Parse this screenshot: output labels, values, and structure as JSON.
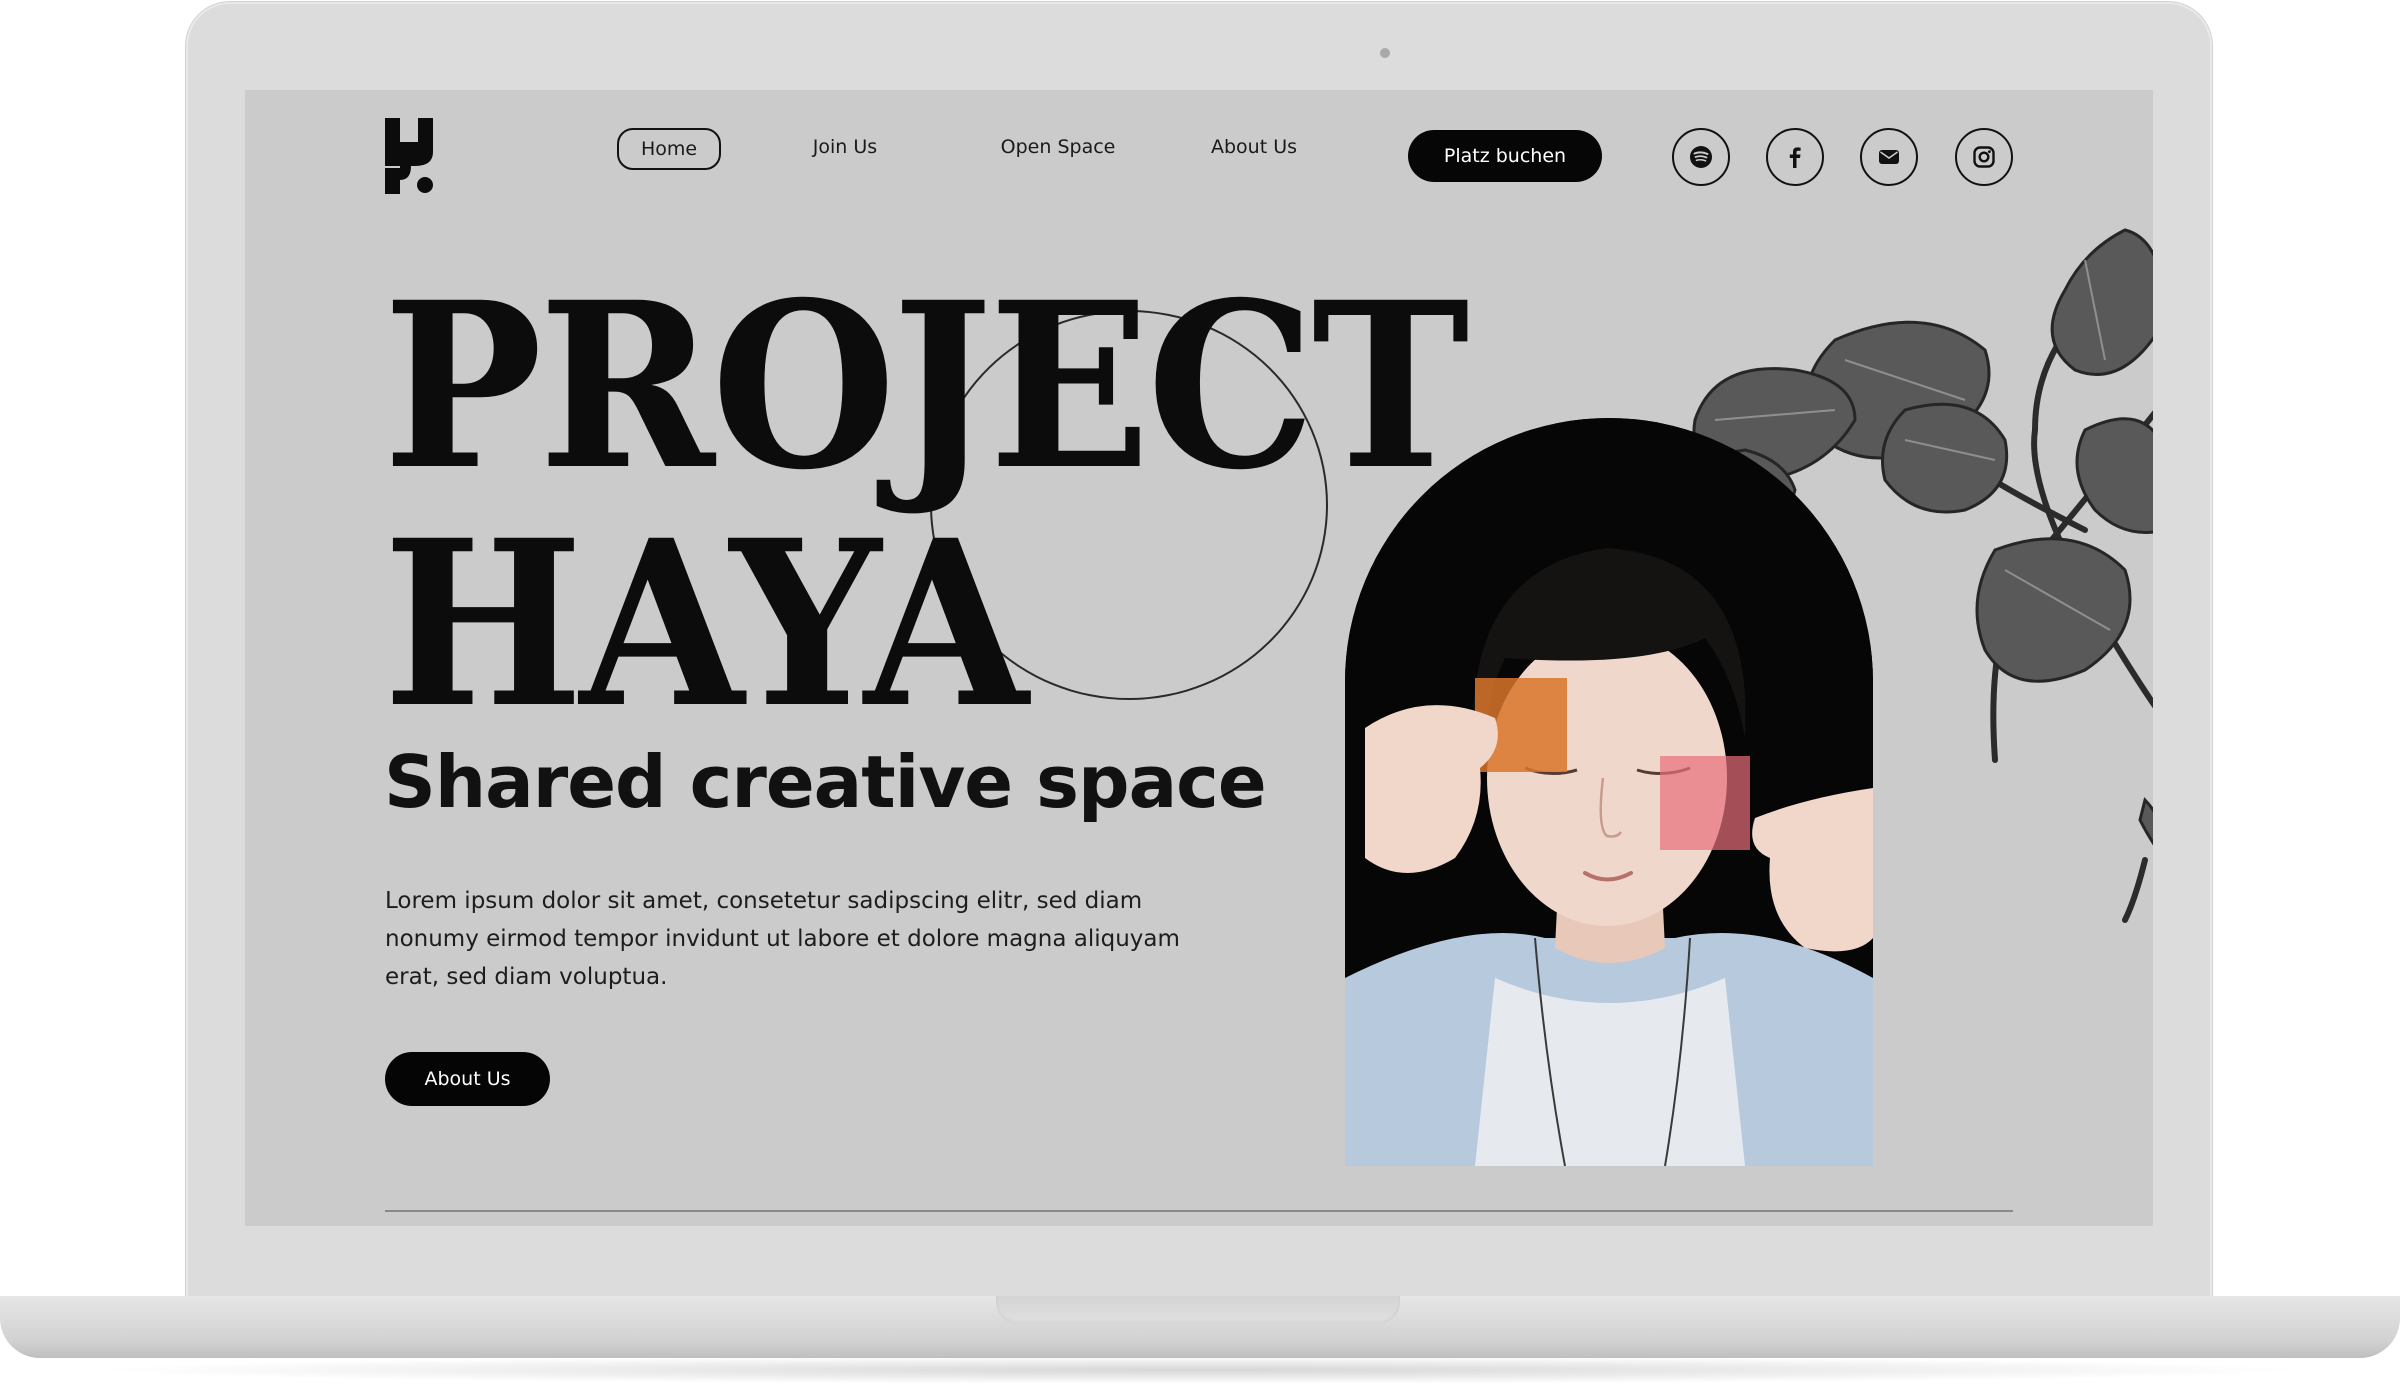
{
  "nav": {
    "home": "Home",
    "join": "Join Us",
    "open_space": "Open Space",
    "about": "About Us",
    "cta": "Platz buchen"
  },
  "social": [
    "spotify-icon",
    "facebook-icon",
    "mail-icon",
    "instagram-icon"
  ],
  "hero": {
    "title_line1": "PROJECT",
    "title_line2": "HAYA",
    "subtitle": "Shared creative space",
    "body": "Lorem ipsum dolor sit amet, consetetur sadipscing elitr, sed diam nonumy eirmod tempor invidunt ut labore et dolore magna aliquyam erat, sed diam voluptua.",
    "button": "About Us"
  },
  "colors": {
    "screen_background": "#cbcbcb",
    "primary_text": "#0c0c0c",
    "button_background": "#060606",
    "button_text": "#ffffff"
  }
}
